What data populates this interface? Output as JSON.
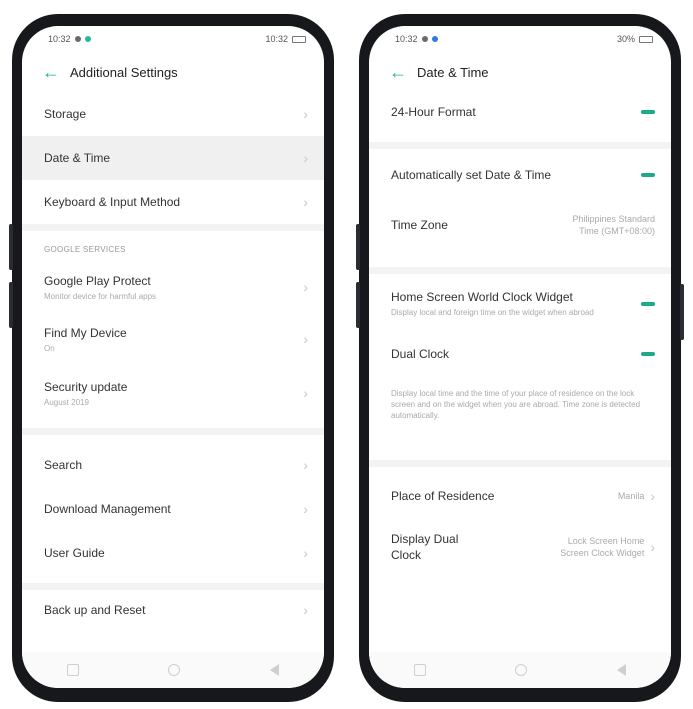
{
  "left_screen": {
    "status": {
      "time": "10:32",
      "right": "10:32"
    },
    "header": {
      "back_icon": "arrow-left-icon",
      "title": "Additional Settings"
    },
    "rows_group1": [
      {
        "label": "Storage"
      },
      {
        "label": "Date & Time"
      },
      {
        "label": "Keyboard & Input Method"
      }
    ],
    "section_label": "GOOGLE SERVICES",
    "rows_group2": [
      {
        "label": "Google Play Protect",
        "sub": "Monitor device for harmful apps"
      },
      {
        "label": "Find My Device",
        "sub": "On"
      },
      {
        "label": "Security update",
        "sub": "August 2019"
      }
    ],
    "rows_group3": [
      {
        "label": "Search"
      },
      {
        "label": "Download Management"
      },
      {
        "label": "User Guide"
      }
    ],
    "rows_group4": [
      {
        "label": "Back up and Reset"
      }
    ]
  },
  "right_screen": {
    "status": {
      "time": "10:32",
      "right": "30%"
    },
    "header": {
      "back_icon": "arrow-left-icon",
      "title": "Date & Time"
    },
    "hour_format": {
      "label": "24-Hour Format",
      "toggle": "on"
    },
    "auto_date": {
      "label": "Automatically set Date & Time",
      "toggle": "on"
    },
    "time_zone": {
      "label": "Time Zone",
      "value_line1": "Philippines Standard",
      "value_line2": "Time (GMT+08:00)"
    },
    "home_clock": {
      "label": "Home Screen World Clock Widget",
      "sub": "Display local and foreign time on the widget when abroad",
      "toggle": "on"
    },
    "dual_clock": {
      "label": "Dual Clock",
      "toggle": "on",
      "desc": "Display local time and the time of your place of residence on the lock screen and on the widget when you are abroad. Time zone is detected automatically."
    },
    "residence": {
      "label": "Place of Residence",
      "value": "Manila"
    },
    "display_dual": {
      "label_line1": "Display Dual",
      "label_line2": "Clock",
      "value_line1": "Lock Screen Home",
      "value_line2": "Screen Clock Widget"
    }
  }
}
